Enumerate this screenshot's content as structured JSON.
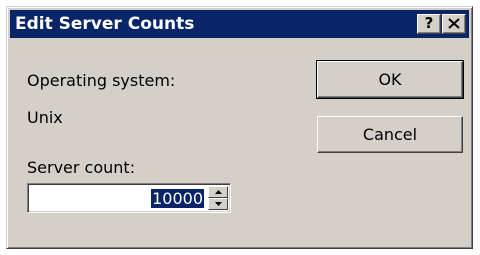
{
  "window": {
    "title": "Edit Server Counts",
    "help_label": "?",
    "close_icon": "close-icon"
  },
  "form": {
    "os_label": "Operating system:",
    "os_value": "Unix",
    "count_label": "Server count:",
    "count_value": "10000"
  },
  "buttons": {
    "ok_label": "OK",
    "cancel_label": "Cancel"
  },
  "colors": {
    "titlebar": "#0a246a",
    "face": "#d4d0c8",
    "selection": "#0a246a"
  }
}
